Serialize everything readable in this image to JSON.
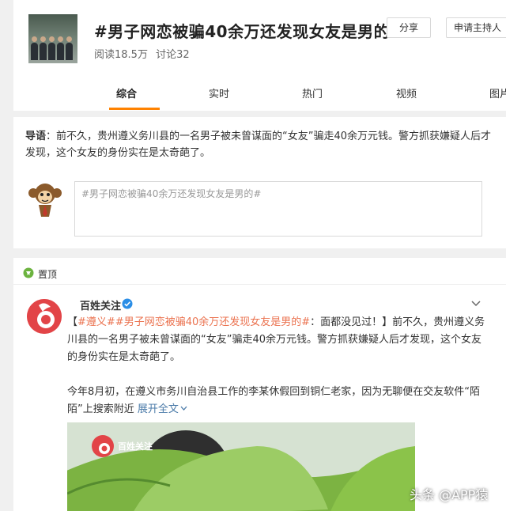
{
  "header": {
    "topic_title": "#男子网恋被骗40余万还发现女友是男的#",
    "read_count": "阅读18.5万",
    "discuss_count": "讨论32",
    "share_label": "分享",
    "apply_host_label": "申请主持人"
  },
  "tabs": [
    {
      "label": "综合",
      "active": true
    },
    {
      "label": "实时",
      "active": false
    },
    {
      "label": "热门",
      "active": false
    },
    {
      "label": "视频",
      "active": false
    },
    {
      "label": "图片",
      "active": false
    }
  ],
  "lead": {
    "prefix": "导语",
    "text": "：前不久，贵州遵义务川县的一名男子被未曾谋面的“女友”骗走40余万元钱。警方抓获嫌疑人后才发现，这个女友的身份实在是太奇葩了。"
  },
  "composer": {
    "value": "#男子网恋被骗40余万还发现女友是男的#"
  },
  "feed": {
    "pinned_label": "置顶",
    "author": "百姓关注",
    "post_prefix": "【",
    "post_link": "#遵义##男子网恋被骗40余万还发现女友是男的#",
    "post_after_link": "：面都没见过！】前不久，贵州遵义务川县的一名男子被未曾谋面的“女友”骗走40余万元钱。警方抓获嫌疑人后才发现，这个女友的身份实在是太奇葩了。",
    "post_para2": "今年8月初，在遵义市务川自治县工作的李某休假回到铜仁老家，因为无聊便在交友软件“陌陌”上搜索附近",
    "expand_label": "展开全文",
    "media_logo_text": "百姓关注"
  },
  "watermark": "头条 @APP猿",
  "colors": {
    "accent_orange": "#ff8200",
    "link_orange": "#eb7350",
    "expand_blue": "#4a7aa8",
    "avatar_red": "#e24447",
    "verified_blue": "#2b8ee6",
    "pin_green": "#6cb33f"
  },
  "icons": [
    "pin-icon",
    "verified-icon",
    "chevron-down-icon",
    "mascot-icon"
  ]
}
